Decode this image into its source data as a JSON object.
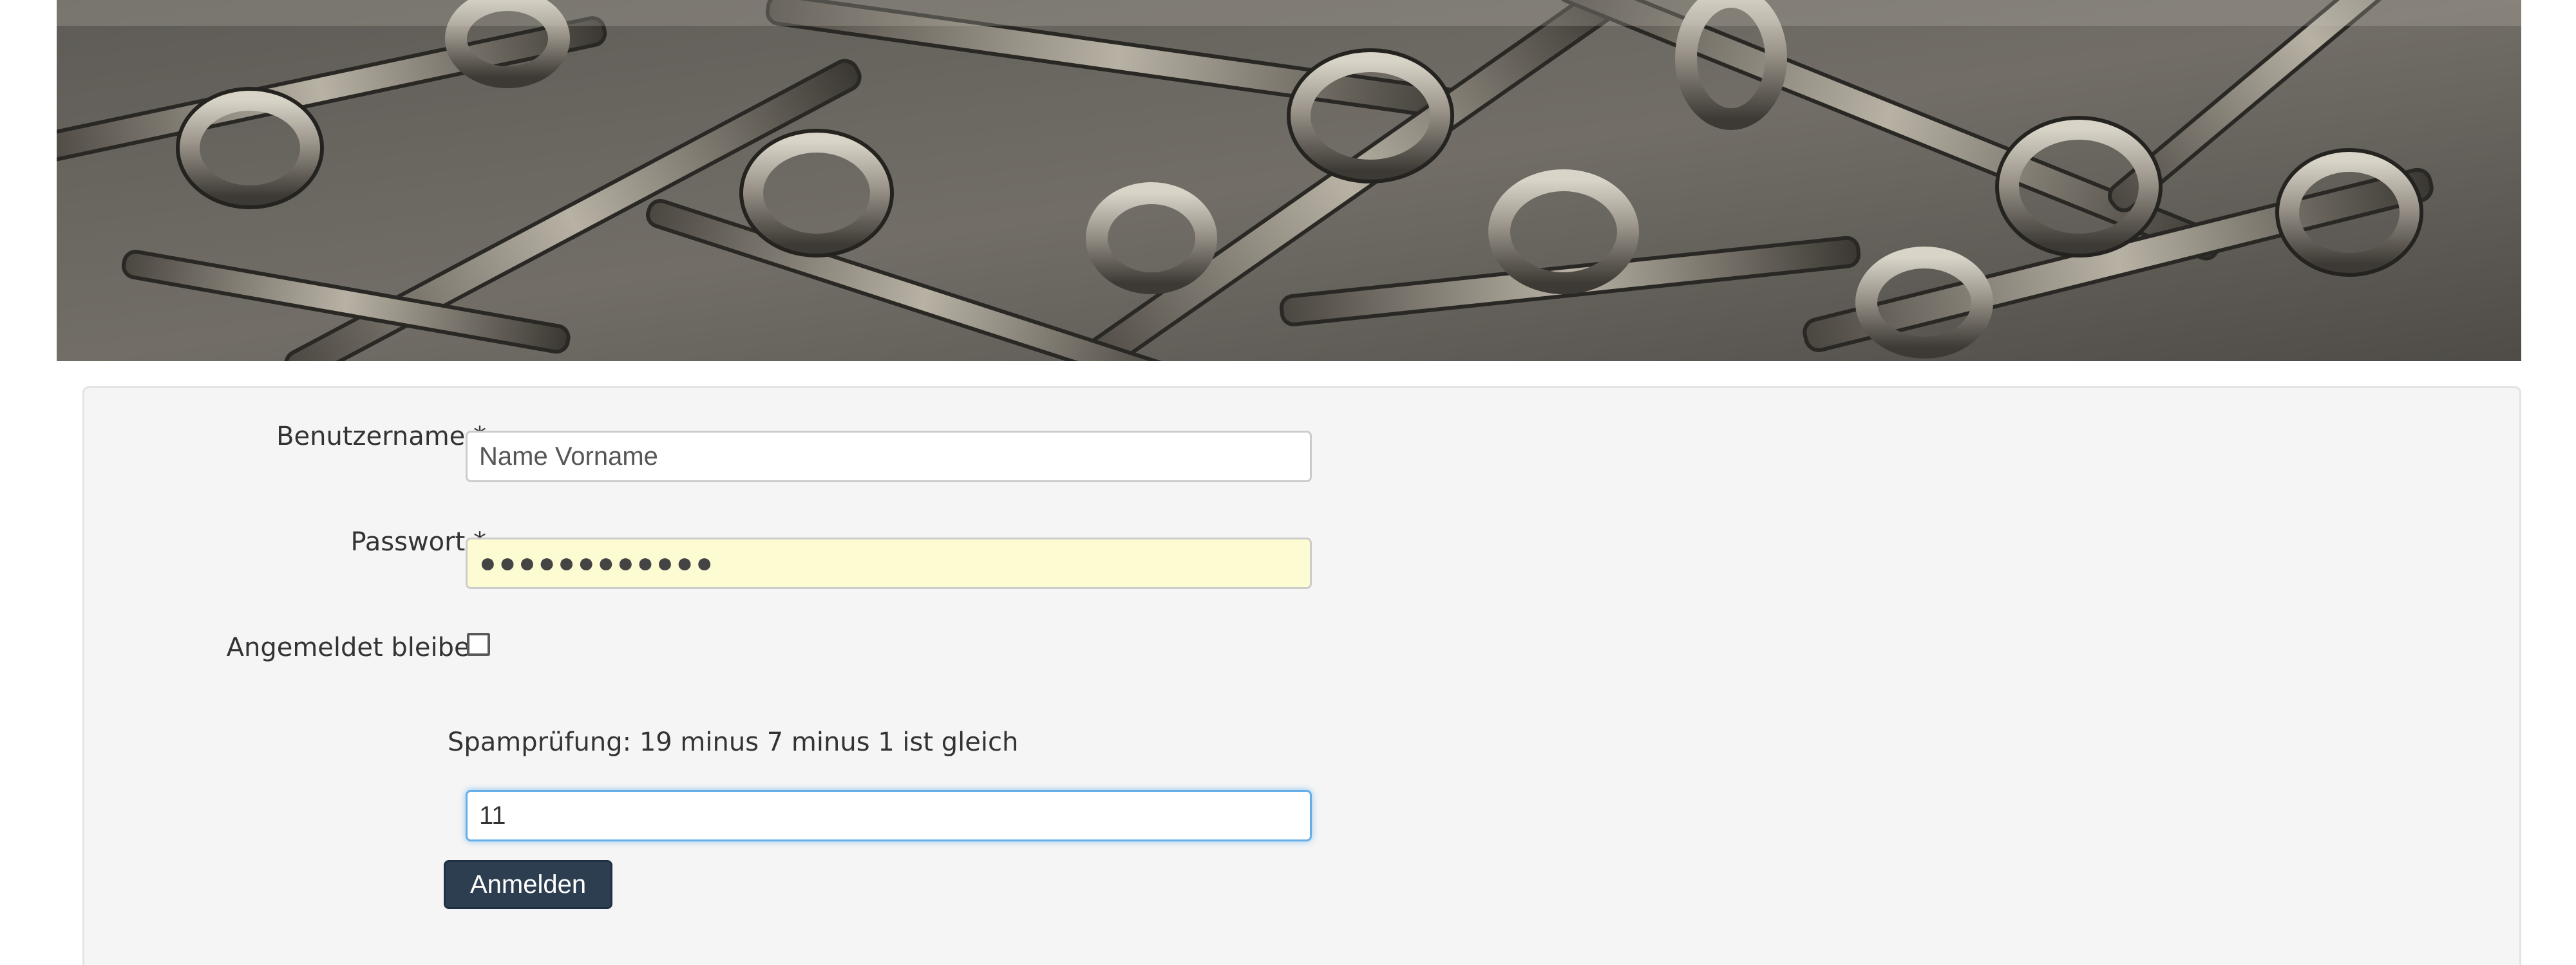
{
  "banner": {
    "image_name": "keys-pile-banner"
  },
  "login_form": {
    "username": {
      "label": "Benutzername *",
      "value": "Name Vorname"
    },
    "password": {
      "label": "Passwort *",
      "masked_value": "●●●●●●●●●●●●"
    },
    "remember_me": {
      "label": "Angemeldet bleiben",
      "checked": false
    },
    "spam_check": {
      "question": "Spamprüfung: 19 minus 7 minus 1 ist gleich",
      "value": "11"
    },
    "submit_label": "Anmelden"
  },
  "colors": {
    "panel_bg": "#f5f5f5",
    "password_autofill_bg": "#fcfbd2",
    "focus_ring": "#66afe9",
    "button_bg": "#2c3e50"
  }
}
